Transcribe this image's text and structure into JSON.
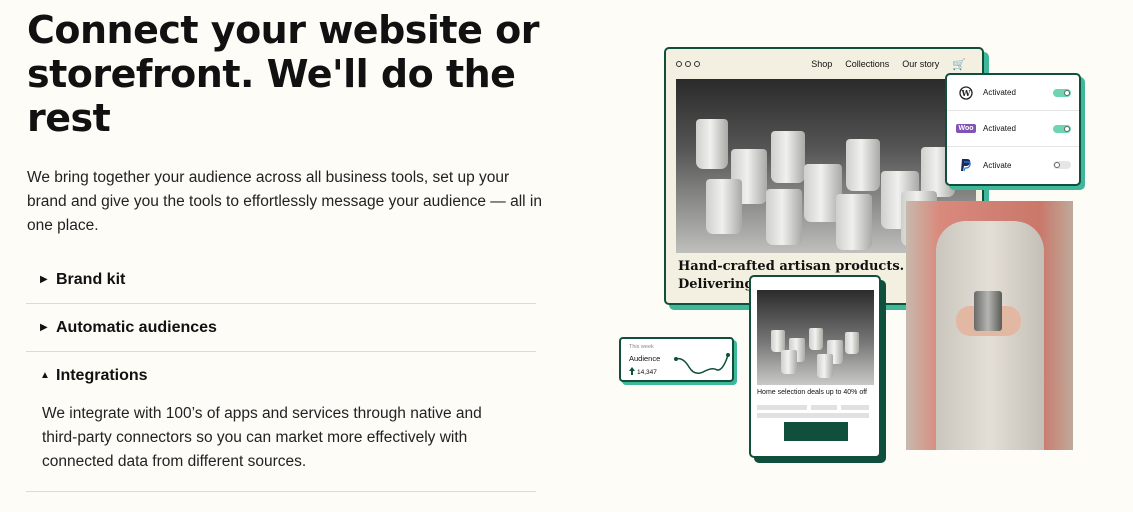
{
  "headline": "Connect your website or storefront. We'll do the rest",
  "intro": "We bring together your audience across all business tools, set up your brand and give you the tools to effortlessly message your audience — all in one place.",
  "accordion": {
    "items": [
      {
        "label": "Brand kit",
        "expanded": false,
        "icon": "triangle-right-icon"
      },
      {
        "label": "Automatic audiences",
        "expanded": false,
        "icon": "triangle-right-icon"
      },
      {
        "label": "Integrations",
        "expanded": true,
        "icon": "triangle-up-icon",
        "body": "We integrate with 100’s of apps and services through native and third-party connectors so you can market more effectively with connected data from different sources."
      }
    ]
  },
  "storefront": {
    "nav": [
      "Shop",
      "Collections",
      "Our story"
    ],
    "cart_icon": "cart-icon",
    "hero_text_line1": "Hand-crafted artisan products.",
    "hero_text_line2": "Delivering"
  },
  "integrations_card": {
    "rows": [
      {
        "logo": "wordpress-icon",
        "status": "Activated",
        "toggle": "on"
      },
      {
        "logo": "woo-icon",
        "logo_text": "Woo",
        "status": "Activated",
        "toggle": "on"
      },
      {
        "logo": "paypal-icon",
        "status": "Activate",
        "toggle": "off"
      }
    ]
  },
  "email_card": {
    "caption": "Home selection deals up to 40% off"
  },
  "audience_card": {
    "period": "This week",
    "label": "Audience",
    "count": "14,347",
    "count_icon": "up-arrow-icon"
  },
  "colors": {
    "accent_dark": "#0f4f3c",
    "accent_mint": "#3fb89a",
    "background": "#fdfcf7"
  }
}
